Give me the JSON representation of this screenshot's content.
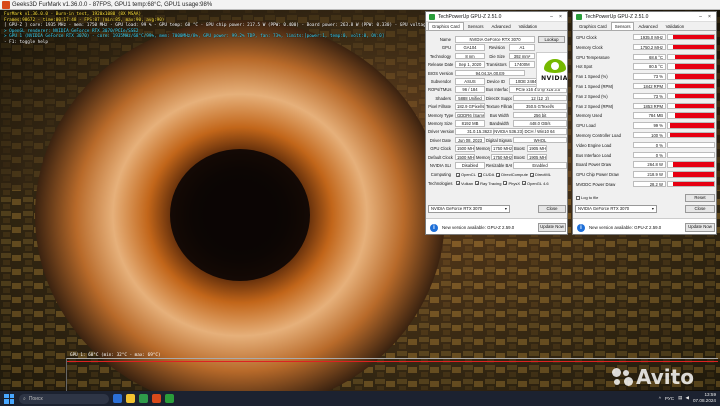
{
  "furmark": {
    "title": "Geeks3D FurMark v1.36.0.0 - 87FPS, GPU1 temp:68°C, GPU1 usage:98%",
    "overlay": [
      {
        "text": "FurMark v1.36.0.0 - Burn-in test, 1920x1080 (8X MSAA)",
        "color": "yellow"
      },
      {
        "text": "Frames:98672 - time:00:17:48 - FPS:87 (min:85, max:90, avg:90)",
        "color": "yellow"
      },
      {
        "text": "[ GPU-Z ] core: 1935 MHz - mem: 1750 MHz - GPU load: 99 % - GPU temp: 68 °C - GPU chip power: 217.5 W (PPW: 0.400) - Board power: 263.8 W (PPW: 0.330) - GPU voltage: 1.075 V",
        "color": "white"
      },
      {
        "text": "> OpenGL renderer: NVIDIA GeForce RTX 3070/PCIe/SSE2",
        "color": "cyan"
      },
      {
        "text": "> GPU 1 (NVIDIA GeForce RTX 3070) - core: 1935MHz/68°C/99%, mem: 7000MHz/8%, GPU power: 99.2% TDP, fan: 73%, limits:[power:1, temp:0, volt:0, OV:0]",
        "color": "cyan"
      },
      {
        "text": "- F1: toggle help",
        "color": "white"
      }
    ],
    "gpu_temp_label": "GPU 1: 68°C (min: 32°C - max: 69°C)"
  },
  "gpuz_card": {
    "title": "TechPowerUp GPU-Z 2.51.0",
    "tabs": [
      "Graphics Card",
      "Sensors",
      "Advanced",
      "Validation"
    ],
    "active_tab": "Graphics Card",
    "lookup_label": "Lookup",
    "uefi_label": "UEFI",
    "logo_word": "NVIDIA",
    "fields": {
      "name_label": "Name",
      "name": "NVIDIA GeForce RTX 3070",
      "gpu_label": "GPU",
      "gpu": "GA104",
      "revision_label": "Revision",
      "revision": "A1",
      "technology_label": "Technology",
      "technology": "8 nm",
      "die_size_label": "Die Size",
      "die_size": "392 mm²",
      "release_date_label": "Release Date",
      "release_date": "Sep 1, 2020",
      "transistors_label": "Transistors",
      "transistors": "17400M",
      "bios_label": "BIOS Version",
      "bios": "94.04.3A.00.E9",
      "subvendor_label": "Subvendor",
      "subvendor": "ASUS",
      "device_id_label": "Device ID",
      "device_id": "10DE 2484 - 1043 87B8",
      "rops_label": "ROPs/TMUs",
      "rops": "96 / 184",
      "bus_label": "Bus Interface",
      "bus": "PCIe x16 4.0 @ x16 3.0",
      "shaders_label": "Shaders",
      "shaders": "5888 Unified",
      "directx_label": "DirectX Support",
      "directx": "12 (12_2)",
      "pixel_label": "Pixel Fillrate",
      "pixel": "182.9 GPixel/s",
      "texture_label": "Texture Fillrate",
      "texture": "350.5 GTexel/s",
      "mem_type_label": "Memory Type",
      "mem_type": "GDDR6 (Samsung)",
      "bus_width_label": "Bus Width",
      "bus_width": "256 bit",
      "mem_size_label": "Memory Size",
      "mem_size": "8192 MB",
      "bandwidth_label": "Bandwidth",
      "bandwidth": "448.0 GB/s",
      "driver_label": "Driver Version",
      "driver": "31.0.15.3623 (NVIDIA 536.23) DCH / Win10 64",
      "driver_date_label": "Driver Date",
      "driver_date": "Jun 08, 2023",
      "dig_sig_label": "Digital Signature",
      "dig_sig": "WHQL",
      "gpu_clock_label": "GPU Clock",
      "gpu_clock": "1500 MHz",
      "memory_label": "Memory",
      "memory_clock": "1750 MHz",
      "boost_label": "Boost",
      "boost": "1905 MHz",
      "default_clock_label": "Default Clock",
      "default_clock": "1500 MHz",
      "default_memory": "1750 MHz",
      "default_boost": "1905 MHz",
      "sli_label": "NVIDIA SLI",
      "sli": "Disabled",
      "rebar_label": "Resizable BAR",
      "rebar": "Enabled",
      "computing_label": "Computing",
      "computing": [
        "OpenCL",
        "CUDA",
        "DirectCompute",
        "DirectML"
      ],
      "technologies_label": "Technologies",
      "technologies": [
        "Vulkan",
        "Ray Tracing",
        "PhysX",
        "OpenGL 4.6"
      ]
    },
    "selected_gpu": "NVIDIA GeForce RTX 3070",
    "close_label": "Close",
    "notice": "New version available: GPU-Z 2.59.0",
    "update_label": "Update Now"
  },
  "gpuz_sensors": {
    "title": "TechPowerUp GPU-Z 2.51.0",
    "tabs": [
      "Graphics Card",
      "Sensors",
      "Advanced",
      "Validation"
    ],
    "active_tab": "Sensors",
    "sensors": [
      {
        "label": "GPU Clock",
        "value": "1935.0 MHz",
        "level": 0.9
      },
      {
        "label": "Memory Clock",
        "value": "1750.2 MHz",
        "level": 0.9
      },
      {
        "label": "GPU Temperature",
        "value": "68.6 °C",
        "level": 0.85
      },
      {
        "label": "Hot Spot",
        "value": "80.5 °C",
        "level": 0.85
      },
      {
        "label": "Fan 1 Speed (%)",
        "value": "73 %",
        "level": 0.85
      },
      {
        "label": "Fan 1 Speed (RPM)",
        "value": "1842 RPM",
        "level": 0.85
      },
      {
        "label": "Fan 2 Speed (%)",
        "value": "73 %",
        "level": 0.85
      },
      {
        "label": "Fan 2 Speed (RPM)",
        "value": "1853 RPM",
        "level": 0.85
      },
      {
        "label": "Memory Used",
        "value": "784 MB",
        "level": 0.85
      },
      {
        "label": "GPU Load",
        "value": "99 %",
        "level": 0.95
      },
      {
        "label": "Memory Controller Load",
        "value": "100 %",
        "level": 0.95
      },
      {
        "label": "Video Engine Load",
        "value": "0 %",
        "level": 0.0
      },
      {
        "label": "Bus Interface Load",
        "value": "0 %",
        "level": 0.0
      },
      {
        "label": "Board Power Draw",
        "value": "264.8 W",
        "level": 0.9
      },
      {
        "label": "GPU Chip Power Draw",
        "value": "218.9 W",
        "level": 0.9
      },
      {
        "label": "MVDDC Power Draw",
        "value": "28.2 W",
        "level": 0.9
      }
    ],
    "log_label": "Log to file",
    "reset_label": "Reset",
    "selected_gpu": "NVIDIA GeForce RTX 3070",
    "close_label": "Close",
    "notice": "New version available: GPU-Z 2.59.0",
    "update_label": "Update Now"
  },
  "taskbar": {
    "search_placeholder": "Поиск",
    "lang": "РУС",
    "time": "13:59",
    "date": "07.08.2024"
  },
  "watermark": "Avito"
}
